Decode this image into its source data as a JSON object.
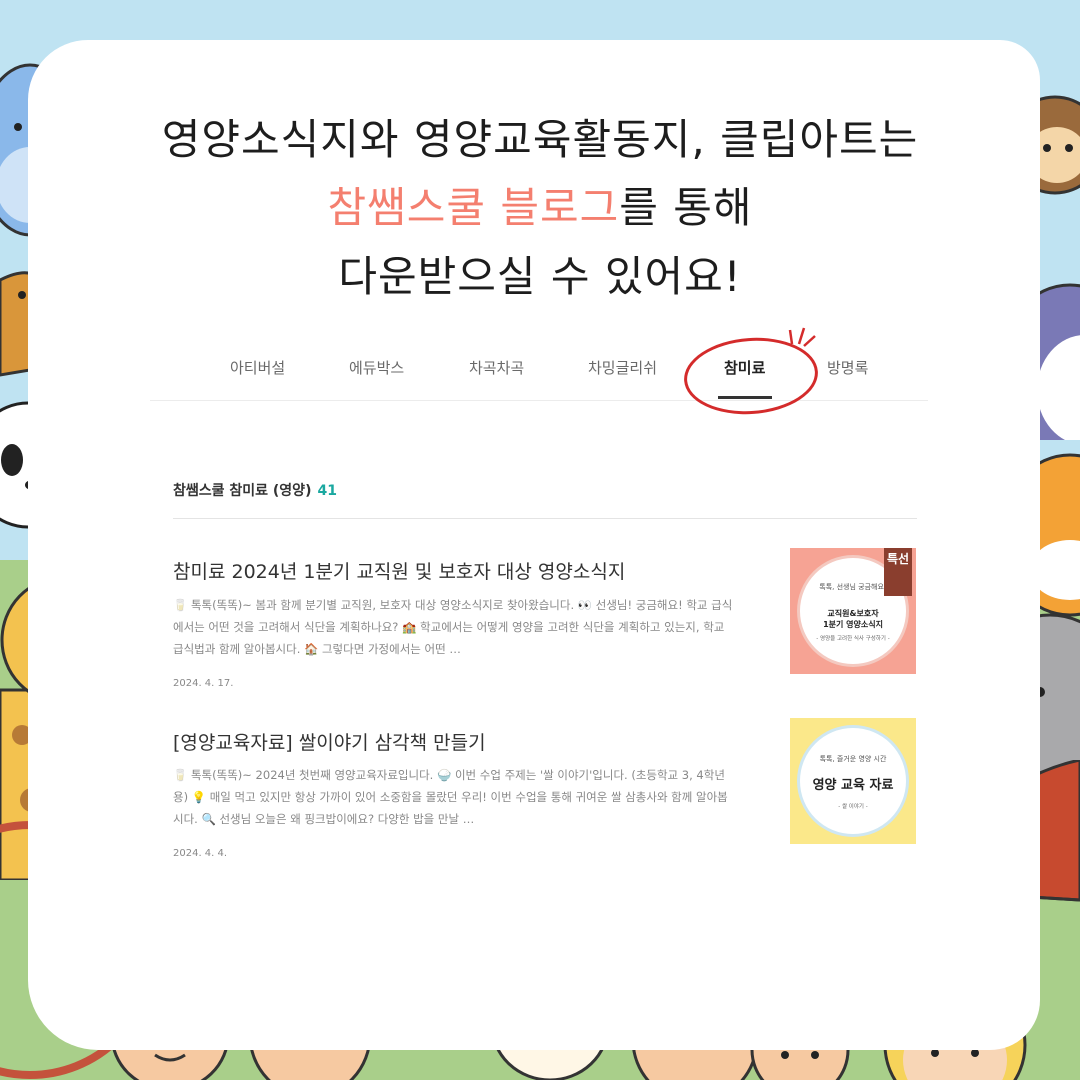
{
  "headline": {
    "line1": "영양소식지와 영양교육활동지, 클립아트는",
    "line2_accent": "참쌤스쿨 블로그",
    "line2_rest": "를 통해",
    "line3": "다운받으실 수 있어요!"
  },
  "tabs": [
    {
      "label": "아티버설"
    },
    {
      "label": "에듀박스"
    },
    {
      "label": "차곡차곡"
    },
    {
      "label": "차밍글리쉬"
    },
    {
      "label": "참미료"
    },
    {
      "label": "방명록"
    }
  ],
  "section": {
    "title": "참쌤스쿨 참미료 (영양)",
    "count": "41"
  },
  "posts": [
    {
      "title": "참미료 2024년 1분기 교직원 및 보호자 대상 영양소식지",
      "excerpt": "🥛 톡톡(똑똑)~ 봄과 함께 분기별 교직원, 보호자 대상 영양소식지로 찾아왔습니다. 👀 선생님! 궁금해요! 학교 급식에서는 어떤 것을 고려해서 식단을 계획하나요? 🏫 학교에서는 어떻게 영양을 고려한 식단을 계획하고 있는지, 학교급식법과 함께 알아봅시다. 🏠 그렇다면 가정에서는 어떤 …",
      "date": "2024. 4. 17.",
      "thumb": {
        "ribbon": "특선",
        "small": "톡톡, 선생님 궁금해요!",
        "main_line1": "교직원&보호자",
        "main_line2": "1분기 영양소식지",
        "sub": "- 영양을 고려한 식사 구성하기 -"
      }
    },
    {
      "title": "[영양교육자료] 쌀이야기 삼각책 만들기",
      "excerpt": "🥛 톡톡(똑똑)~ 2024년 첫번째 영양교육자료입니다. 🍚 이번 수업 주제는 '쌀 이야기'입니다. (초등학교 3, 4학년용) 💡 매일 먹고 있지만 항상 가까이 있어 소중함을 몰랐던 우리! 이번 수업을 통해 귀여운 쌀 삼총사와 함께 알아봅시다. 🔍 선생님 오늘은 왜 핑크밥이에요? 다양한 밥을 만날 …",
      "date": "2024. 4. 4.",
      "thumb": {
        "small": "톡톡, 즐거운 영양 시간",
        "main_line1": "영양 교육 자료",
        "sub": "- 쌀 이야기 -"
      }
    }
  ],
  "colors": {
    "accent": "#f47f6f",
    "count": "#1aa8a0",
    "sky": "#bfe3f2",
    "grass": "#a9cf8a",
    "circle_mark": "#d42b2b"
  },
  "decorations": [
    "seal-icon",
    "monkey-icon",
    "squirrel-icon",
    "penguin-icon",
    "panda-icon",
    "tiger-icon",
    "giraffe-icon",
    "elephant-icon",
    "ferris-wheel-icon",
    "carousel-icon",
    "grandma-icon",
    "grandpa-icon",
    "bunny-icon",
    "family-icon",
    "girl-icon"
  ]
}
